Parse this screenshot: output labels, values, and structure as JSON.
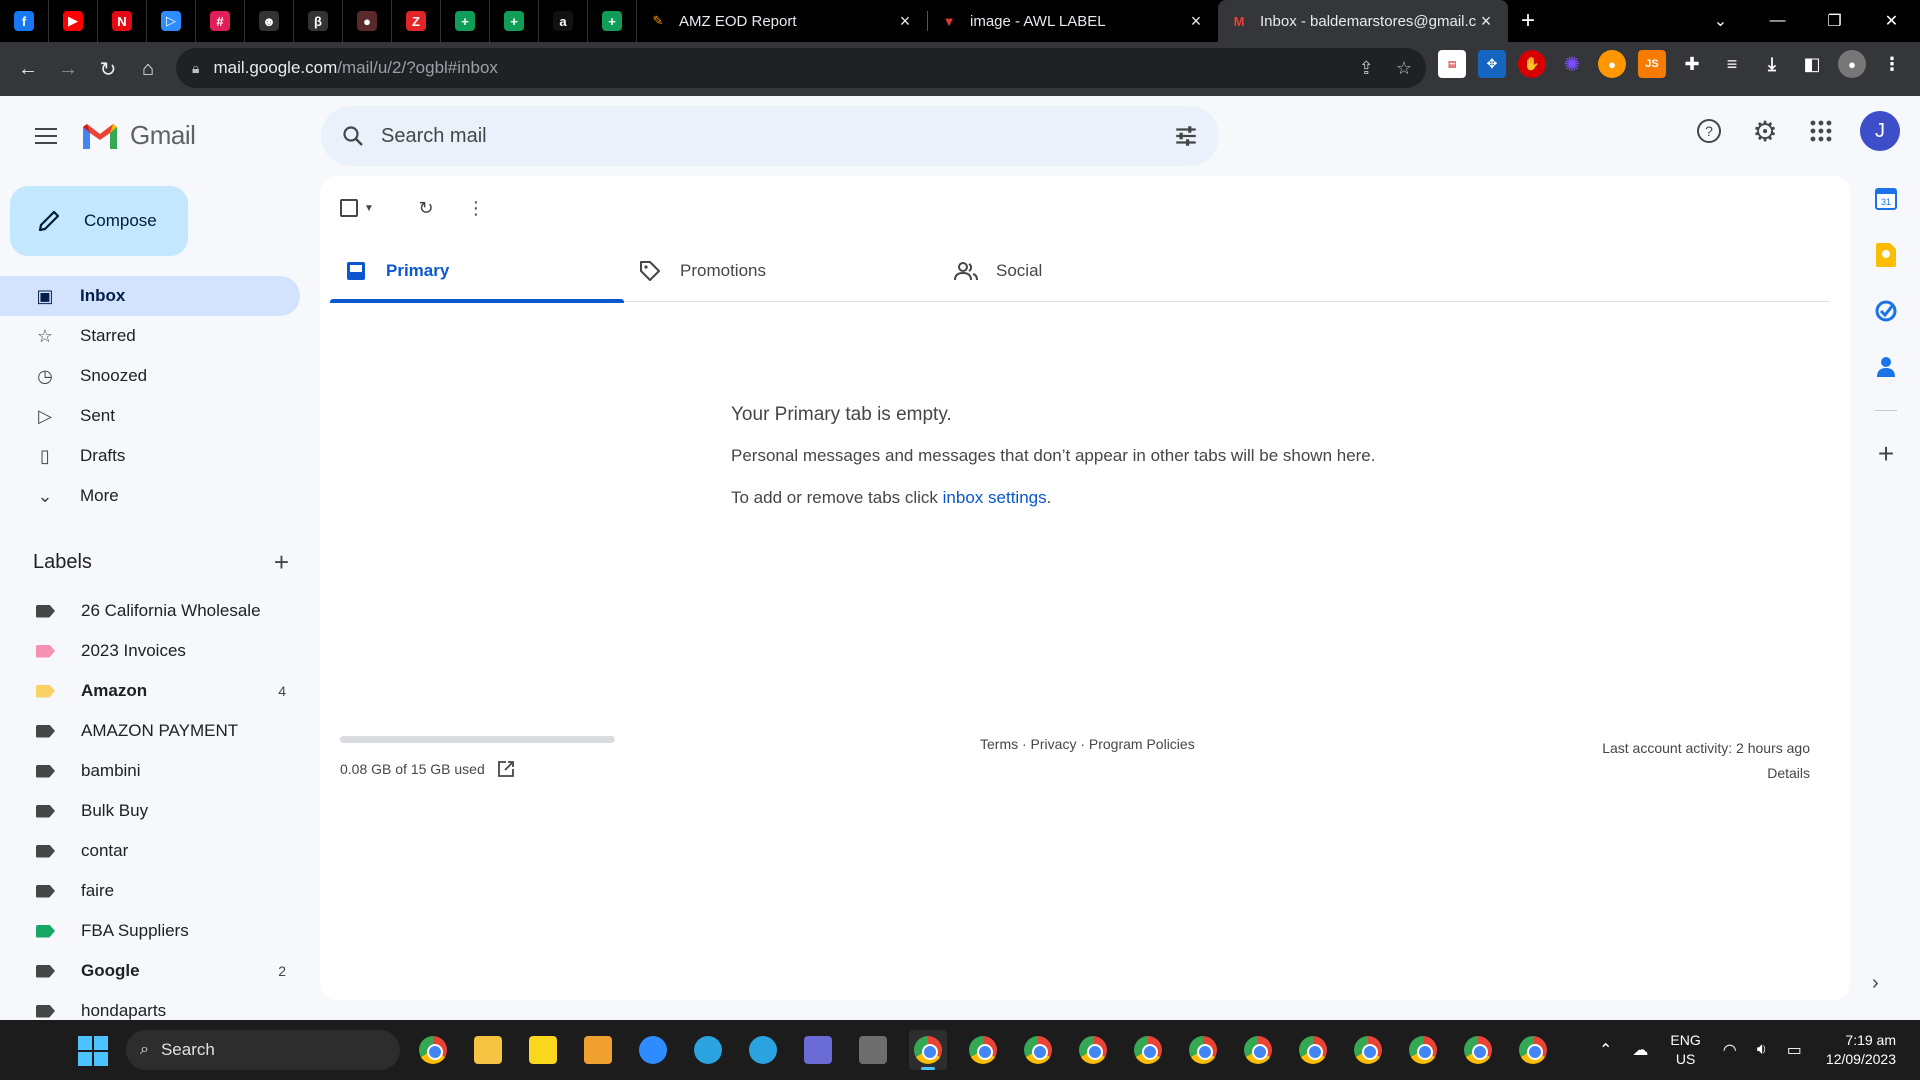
{
  "browser": {
    "pinned_tabs": [
      {
        "icon": "facebook-icon",
        "glyph": "f",
        "color": "#1877f2"
      },
      {
        "icon": "youtube-icon",
        "glyph": "▶",
        "color": "#ff0000"
      },
      {
        "icon": "netflix-icon",
        "glyph": "N",
        "color": "#e50914"
      },
      {
        "icon": "play-icon",
        "glyph": "▷",
        "color": "#2d8cff"
      },
      {
        "icon": "slack-icon",
        "glyph": "#",
        "color": "#e01e5a"
      },
      {
        "icon": "snapchat-icon",
        "glyph": "☻",
        "color": "#333333"
      },
      {
        "icon": "app-icon",
        "glyph": "β",
        "color": "#333333"
      },
      {
        "icon": "avatar-tab-icon",
        "glyph": "●",
        "color": "#5a2a2a"
      },
      {
        "icon": "zoho-icon",
        "glyph": "Z",
        "color": "#e42527"
      },
      {
        "icon": "sheets-icon",
        "glyph": "+",
        "color": "#0f9d58"
      },
      {
        "icon": "sheets-icon",
        "glyph": "+",
        "color": "#0f9d58"
      },
      {
        "icon": "amazon-icon",
        "glyph": "a",
        "color": "#111111"
      },
      {
        "icon": "sheets-icon",
        "glyph": "+",
        "color": "#0f9d58"
      }
    ],
    "tabs": [
      {
        "title": "AMZ EOD Report",
        "icon": "report-icon",
        "active": false
      },
      {
        "title": "image - AWL LABEL",
        "icon": "awl-icon",
        "active": false
      },
      {
        "title": "Inbox - baldemarstores@gmail.co",
        "icon": "gmail-icon",
        "active": true
      }
    ],
    "url_host": "mail.google.com",
    "url_path": "/mail/u/2/?ogbl#inbox"
  },
  "gmail": {
    "brand": "Gmail",
    "search_placeholder": "Search mail",
    "avatar_letter": "J",
    "compose_label": "Compose",
    "nav": [
      {
        "label": "Inbox",
        "icon": "inbox-icon",
        "glyph": "▣",
        "active": true
      },
      {
        "label": "Starred",
        "icon": "star-icon",
        "glyph": "☆",
        "active": false
      },
      {
        "label": "Snoozed",
        "icon": "clock-icon",
        "glyph": "◷",
        "active": false
      },
      {
        "label": "Sent",
        "icon": "send-icon",
        "glyph": "▷",
        "active": false
      },
      {
        "label": "Drafts",
        "icon": "draft-icon",
        "glyph": "▯",
        "active": false
      },
      {
        "label": "More",
        "icon": "chevron-down-icon",
        "glyph": "⌄",
        "active": false
      }
    ],
    "labels_heading": "Labels",
    "labels": [
      {
        "name": "26 California Wholesale",
        "color": "#444746",
        "count": "",
        "bold": false
      },
      {
        "name": "2023 Invoices",
        "color": "#f691b2",
        "count": "",
        "bold": false
      },
      {
        "name": "Amazon",
        "color": "#fad165",
        "count": "4",
        "bold": true
      },
      {
        "name": "AMAZON PAYMENT",
        "color": "#444746",
        "count": "",
        "bold": false
      },
      {
        "name": "bambini",
        "color": "#444746",
        "count": "",
        "bold": false
      },
      {
        "name": "Bulk Buy",
        "color": "#444746",
        "count": "",
        "bold": false
      },
      {
        "name": "contar",
        "color": "#444746",
        "count": "",
        "bold": false
      },
      {
        "name": "faire",
        "color": "#444746",
        "count": "",
        "bold": false
      },
      {
        "name": "FBA Suppliers",
        "color": "#16a765",
        "count": "",
        "bold": false
      },
      {
        "name": "Google",
        "color": "#444746",
        "count": "2",
        "bold": true
      },
      {
        "name": "hondaparts",
        "color": "#444746",
        "count": "",
        "bold": false
      }
    ],
    "tabs": [
      {
        "label": "Primary",
        "icon": "inbox-tab-icon",
        "active": true
      },
      {
        "label": "Promotions",
        "icon": "tag-icon",
        "active": false
      },
      {
        "label": "Social",
        "icon": "people-icon",
        "active": false
      }
    ],
    "empty_title": "Your Primary tab is empty.",
    "empty_body": "Personal messages and messages that don’t appear in other tabs will be shown here.",
    "empty_tabs_prefix": "To add or remove tabs click ",
    "empty_tabs_link": "inbox settings",
    "empty_tabs_suffix": ".",
    "storage_text": "0.08 GB of 15 GB used",
    "storage_fraction": 0.005,
    "footer_links": "Terms · Privacy · Program Policies",
    "last_activity": "Last account activity: 2 hours ago",
    "details_link": "Details"
  },
  "taskbar": {
    "search_label": "Search",
    "lang_line1": "ENG",
    "lang_line2": "US",
    "time": "7:19 am",
    "date": "12/09/2023"
  }
}
